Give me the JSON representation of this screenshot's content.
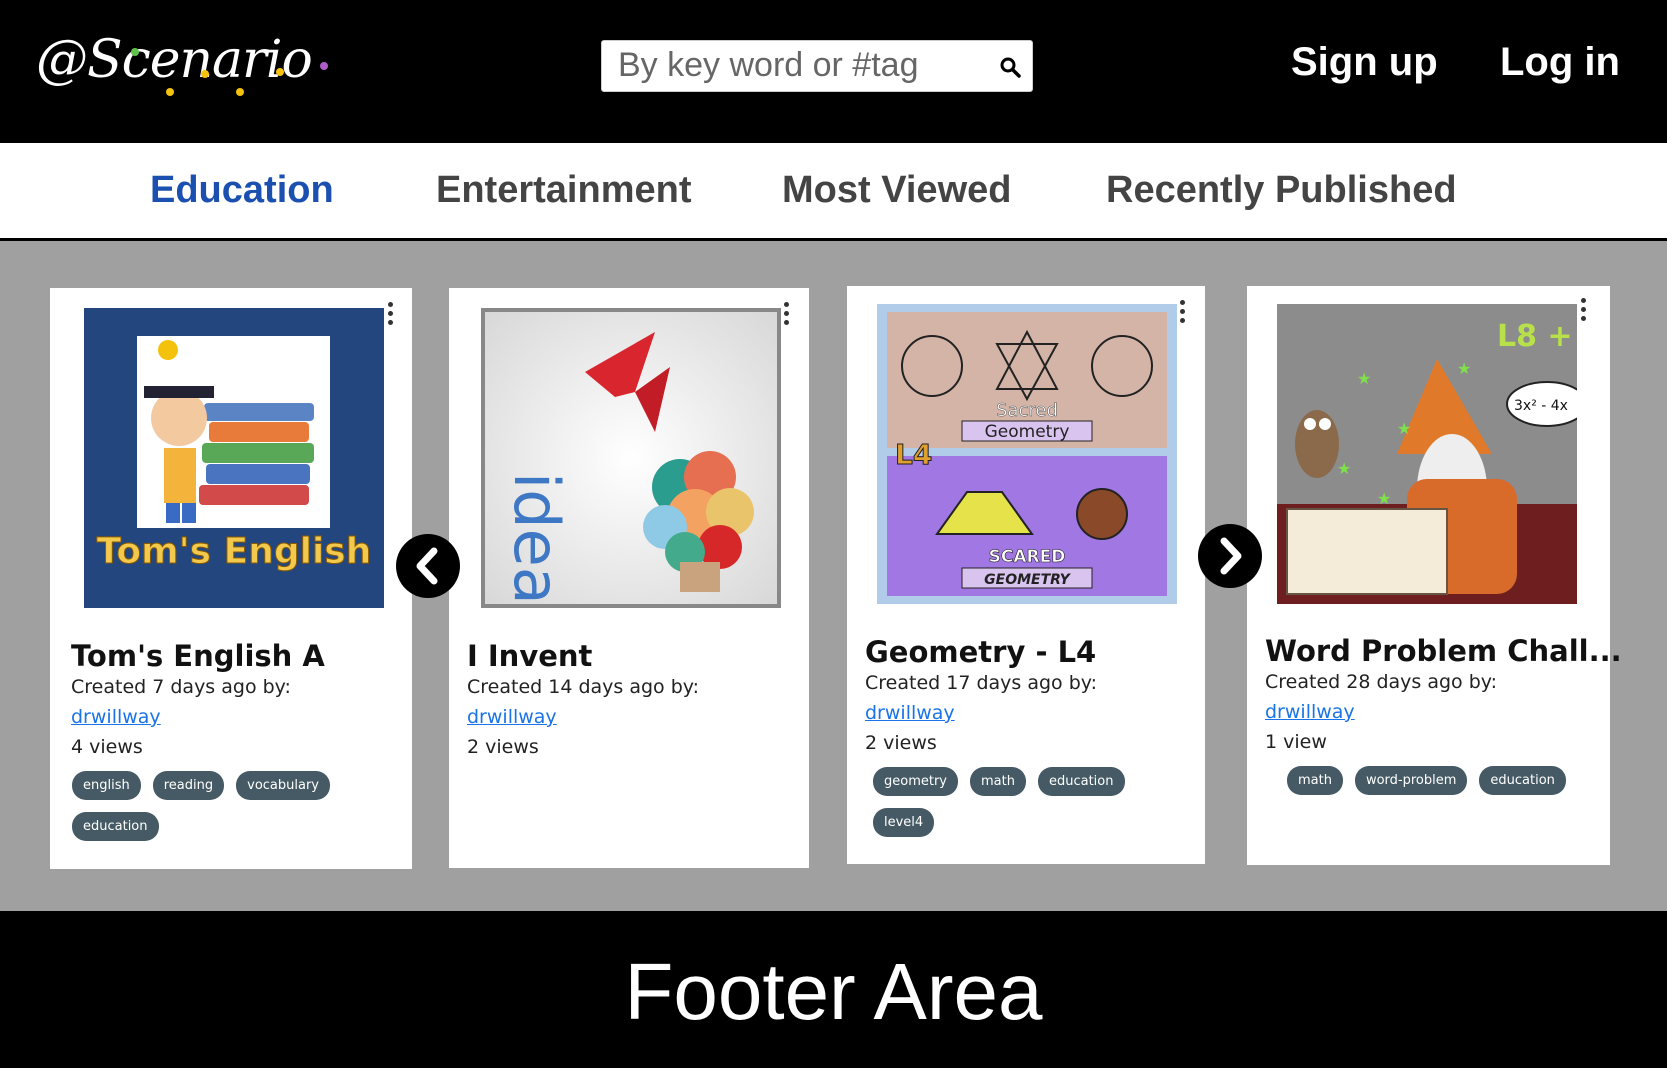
{
  "header": {
    "logo_text": "@Scenario",
    "search_placeholder": "By key word or #tag",
    "signup_label": "Sign up",
    "login_label": "Log in"
  },
  "tabs": [
    {
      "label": "Education",
      "active": true
    },
    {
      "label": "Entertainment",
      "active": false
    },
    {
      "label": "Most Viewed",
      "active": false
    },
    {
      "label": "Recently Published",
      "active": false
    }
  ],
  "cards": [
    {
      "title": "Tom's English A",
      "created": "Created 7 days ago by:",
      "author": "drwillway",
      "views": "4 views",
      "tags": [
        "english",
        "reading",
        "vocabulary",
        "education"
      ],
      "thumb_text": "Tom's English"
    },
    {
      "title": "I Invent",
      "created": "Created 14 days ago by:",
      "author": "drwillway",
      "views": "2 views",
      "tags": [],
      "thumb_text": "ideas"
    },
    {
      "title": "Geometry - L4",
      "created": "Created 17 days ago by:",
      "author": "drwillway",
      "views": "2 views",
      "tags": [
        "geometry",
        "math",
        "education",
        "level4"
      ],
      "thumb_text_top": "Sacred",
      "thumb_text_top2": "Geometry",
      "thumb_text_bottom": "SCARED",
      "thumb_text_bottom2": "GEOMETRY",
      "thumb_badge": "L4"
    },
    {
      "title": "Word Problem Chall...",
      "created": "Created 28 days ago by:",
      "author": "drwillway",
      "views": "1 view",
      "tags": [
        "math",
        "word-problem",
        "education"
      ],
      "thumb_badge": "L8 +",
      "thumb_bubble": "3x² - 4x"
    }
  ],
  "footer": {
    "text": "Footer Area"
  },
  "colors": {
    "active_tab": "#1b4fb0",
    "tag_bg": "#455a64",
    "link": "#1a73e8",
    "page_bg": "#a0a0a0"
  }
}
